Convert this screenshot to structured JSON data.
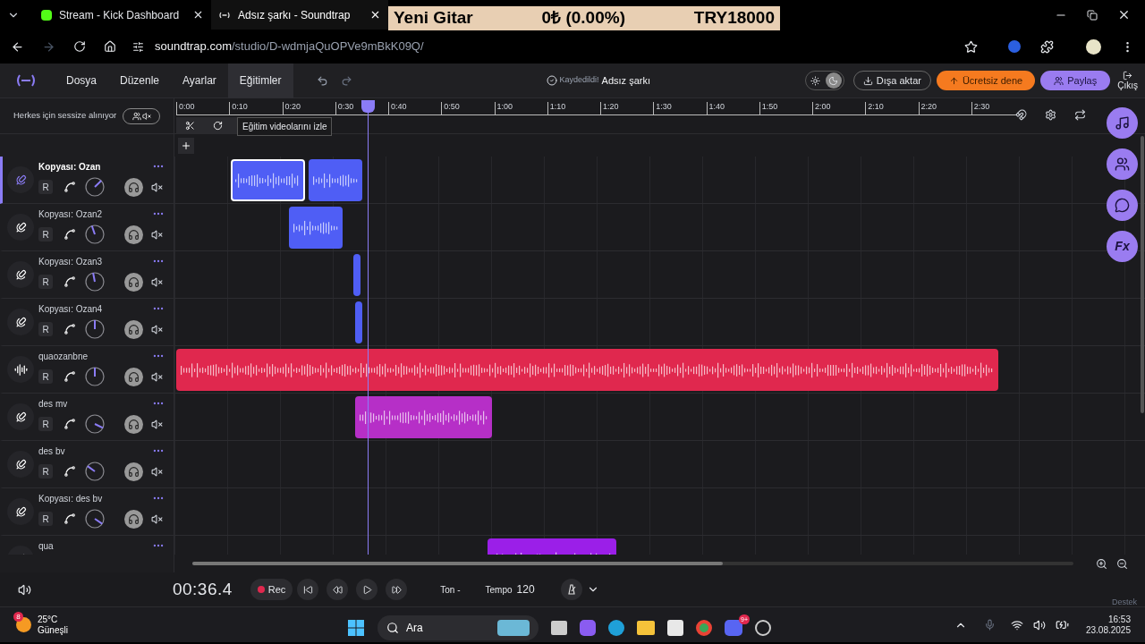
{
  "browser": {
    "tabs": [
      {
        "title": "Stream - Kick Dashboard",
        "selected": false
      },
      {
        "title": "Adsız şarkı - Soundtrap",
        "selected": true
      }
    ],
    "overlay": {
      "item": "Yeni Gitar",
      "change": "0₺ (0.00%)",
      "price": "TRY18000"
    },
    "url_domain": "soundtrap.com",
    "url_path": "/studio/D-wdmjaQuOPVe9mBkK09Q/"
  },
  "menu": [
    {
      "label": "Dosya",
      "selected": false
    },
    {
      "label": "Düzenle",
      "selected": false
    },
    {
      "label": "Ayarlar",
      "selected": false
    },
    {
      "label": "Eğitimler",
      "selected": true
    }
  ],
  "save_status": "Kaydedildi!",
  "song_title": "Adsız şarkı",
  "dark_mode": true,
  "buttons": {
    "export": "Dışa aktar",
    "trial": "Ücretsiz dene",
    "share": "Paylaş",
    "exit": "Çıkış"
  },
  "effects_label": "Fx",
  "mute_all_label": "Herkes için sessize alınıyor",
  "tooltip": "Eğitim videolarını izle",
  "ruler": [
    "0:00",
    "0:10",
    "0:20",
    "0:30",
    "0:40",
    "0:50",
    "1:00",
    "1:10",
    "1:20",
    "1:30",
    "1:40",
    "1:50",
    "2:00",
    "2:10",
    "2:20",
    "2:30"
  ],
  "tracks": [
    {
      "name": "Kopyası: Ozan",
      "kind": "mic",
      "selected": true,
      "level": 0.67,
      "record": "R",
      "clips": [
        {
          "selected": true,
          "color": "#4f5ef5"
        },
        {
          "selected": false,
          "color": "#4f5ef5"
        }
      ]
    },
    {
      "name": "Kopyası: Ozan2",
      "kind": "mic",
      "selected": false,
      "level": 0.43,
      "record": "R",
      "clips": [
        {
          "selected": false,
          "color": "#4f5ef5"
        }
      ]
    },
    {
      "name": "Kopyası: Ozan3",
      "kind": "mic",
      "selected": false,
      "level": 0.46,
      "record": "R",
      "clips": [
        {
          "selected": false,
          "color": "#4f5ef5"
        }
      ]
    },
    {
      "name": "Kopyası: Ozan4",
      "kind": "mic",
      "selected": false,
      "level": 0.5,
      "record": "R",
      "clips": [
        {
          "selected": false,
          "color": "#4f5ef5"
        }
      ]
    },
    {
      "name": "quaozanbne",
      "kind": "audio",
      "selected": false,
      "level": 0.5,
      "record": "R",
      "clips": [
        {
          "selected": false,
          "color": "#e0284e"
        }
      ]
    },
    {
      "name": "des mv",
      "kind": "mic",
      "selected": false,
      "level": 0.93,
      "record": "R",
      "clips": [
        {
          "selected": false,
          "color": "#b62fc7"
        }
      ]
    },
    {
      "name": "des bv",
      "kind": "mic",
      "selected": false,
      "level": 0.3,
      "record": "R"
    },
    {
      "name": "Kopyası: des bv",
      "kind": "mic",
      "selected": false,
      "level": 0.96,
      "record": "R"
    },
    {
      "name": "qua",
      "kind": "mic",
      "selected": false,
      "clips": [
        {
          "selected": false,
          "color": "#9b1fe8"
        }
      ]
    }
  ],
  "transport": {
    "time": "00:36.4",
    "rec": "Rec",
    "key": "Ton -",
    "tempo_label": "Tempo",
    "tempo": "120"
  },
  "support": "Destek",
  "taskbar": {
    "temperature": "25°C",
    "weather": "Güneşli",
    "weather_badge": "8",
    "search": "Ara",
    "chat_badge": "9+",
    "time": "16:53",
    "date": "23.08.2025"
  }
}
